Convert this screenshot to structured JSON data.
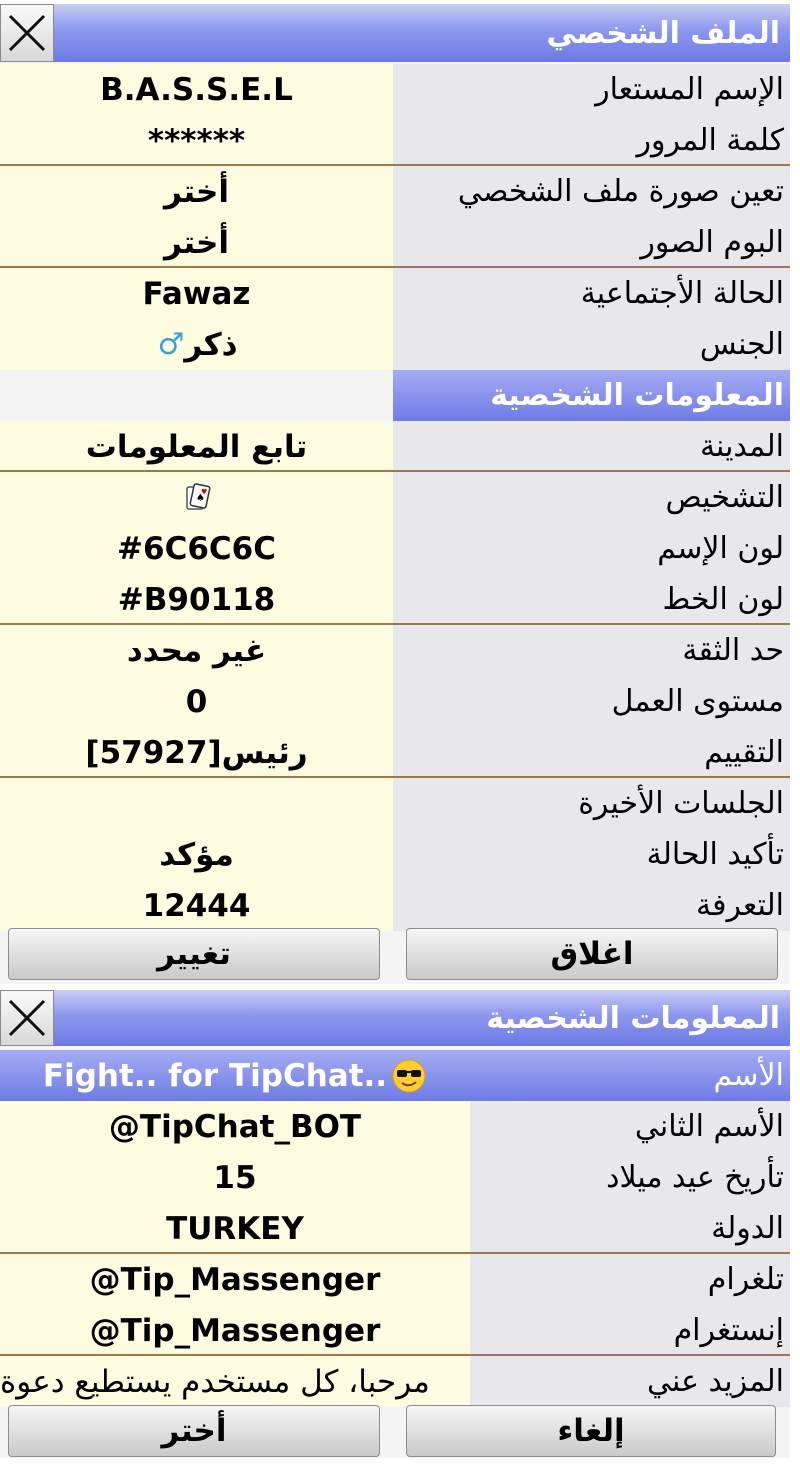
{
  "profile": {
    "title": "الملف الشخصي",
    "rows": [
      {
        "label": "الإسم المستعار",
        "value": "B.A.S.S.E.L"
      },
      {
        "label": "كلمة المرور",
        "value": "******"
      },
      {
        "label": "تعين صورة ملف الشخصي",
        "value": "أختر"
      },
      {
        "label": "البوم الصور",
        "value": "أختر"
      },
      {
        "label": "الحالة الأجتماعية",
        "value": "Fawaz"
      },
      {
        "label": "الجنس",
        "value": "ذكر",
        "icon": "male-sign-icon"
      }
    ],
    "section_header": "المعلومات الشخصية",
    "rows2": [
      {
        "label": "المدينة",
        "value": "تابع المعلومات"
      },
      {
        "label": "التشخيص",
        "value": "",
        "icon": "playing-card-icon"
      },
      {
        "label": "لون الإسم",
        "value": "#6C6C6C"
      },
      {
        "label": "لون الخط",
        "value": "#B90118"
      },
      {
        "label": "حد الثقة",
        "value": "غير محدد"
      },
      {
        "label": "مستوى العمل",
        "value": "0"
      },
      {
        "label": "التقييم",
        "value": "رئيس[57927]"
      },
      {
        "label": "الجلسات الأخيرة",
        "value": ""
      },
      {
        "label": "تأكيد الحالة",
        "value": "مؤكد"
      },
      {
        "label": "التعرفة",
        "value": "12444"
      }
    ],
    "buttons": {
      "change": "تغيير",
      "close": "اغلاق"
    }
  },
  "personal": {
    "title": "المعلومات الشخصية",
    "rows": [
      {
        "label": "الأسم",
        "value": "Fight.. for TipChat.."
      },
      {
        "label": "الأسم الثاني",
        "value": "@TipChat_BOT"
      },
      {
        "label": "تأريخ عيد ميلاد",
        "value": "15"
      },
      {
        "label": "الدولة",
        "value": "TURKEY"
      },
      {
        "label": "تلغرام",
        "value": "@Tip_Massenger"
      },
      {
        "label": "إنستغرام",
        "value": "@Tip_Massenger"
      },
      {
        "label": "المزيد عني",
        "value": "مرحبا، كل مستخدم يستطيع دعوة"
      }
    ],
    "buttons": {
      "choose": "أختر",
      "cancel": "إلغاء"
    }
  },
  "colors": {
    "accent": "#6c79e6",
    "value_bg": "#fdfce0",
    "label_bg": "#e8e8ec",
    "separator": "#9c7a4c"
  }
}
